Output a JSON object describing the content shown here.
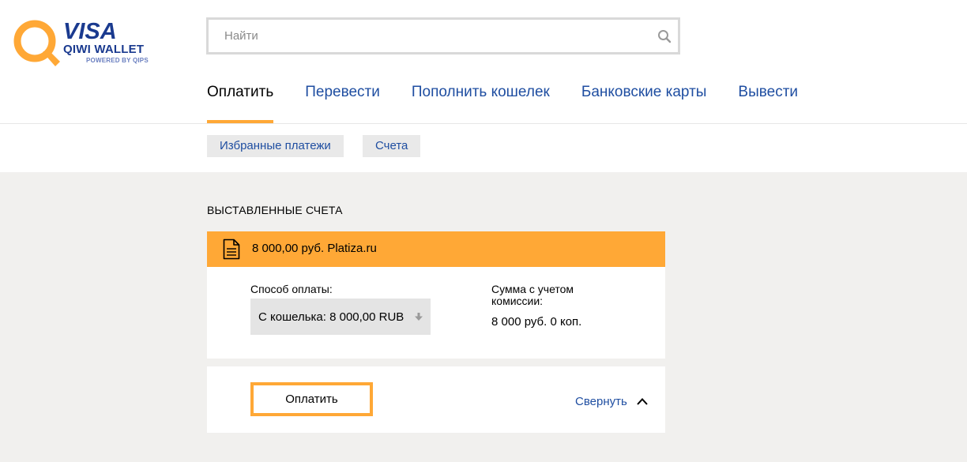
{
  "logo": {
    "brand": "VISA",
    "product": "QIWI WALLET",
    "tagline": "POWERED BY QIPS"
  },
  "search": {
    "placeholder": "Найти",
    "value": ""
  },
  "nav": {
    "items": [
      {
        "label": "Оплатить",
        "active": true
      },
      {
        "label": "Перевести",
        "active": false
      },
      {
        "label": "Пополнить кошелек",
        "active": false
      },
      {
        "label": "Банковские карты",
        "active": false
      },
      {
        "label": "Вывести",
        "active": false
      }
    ]
  },
  "subnav": {
    "items": [
      {
        "label": "Избранные платежи"
      },
      {
        "label": "Счета"
      }
    ]
  },
  "invoices": {
    "title": "ВЫСТАВЛЕННЫЕ СЧЕТА",
    "item": {
      "summary": "8 000,00 руб. Platiza.ru",
      "payment_method_label": "Способ оплаты:",
      "payment_method_value": "С кошелька: 8 000,00 RUB",
      "total_label": "Сумма с учетом комиссии:",
      "total_value": "8 000 руб. 0 коп."
    },
    "pay_label": "Оплатить",
    "collapse_label": "Свернуть"
  },
  "colors": {
    "accent": "#ffa836",
    "link": "#1f4ea1",
    "brand_blue": "#1a3a8f",
    "background": "#f1f0ee"
  },
  "icons": {
    "search": "search-icon",
    "document": "document-icon",
    "dropdown": "arrow-down-icon",
    "collapse": "chevron-up-icon"
  }
}
